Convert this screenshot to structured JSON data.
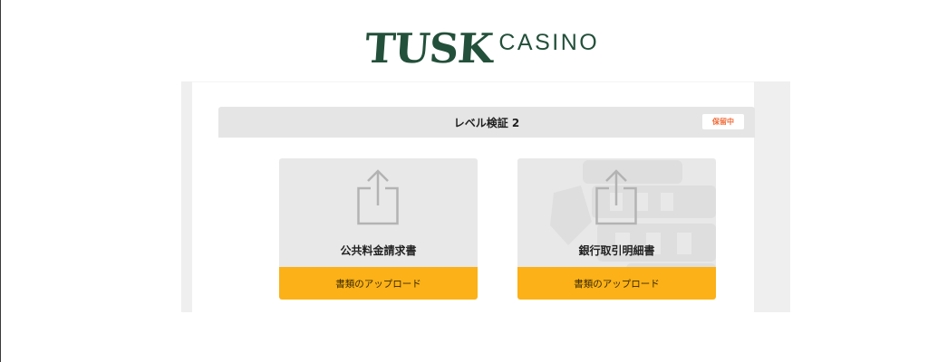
{
  "brand": {
    "name_primary": "TUSK",
    "name_secondary": "CASINO",
    "color": "#23503a"
  },
  "verification": {
    "title": "レベル検証 2",
    "status": "保留中",
    "status_color": "#f06a36"
  },
  "documents": [
    {
      "title": "公共料金請求書",
      "button_label": "書類のアップロード",
      "icon": "upload-icon"
    },
    {
      "title": "銀行取引明細書",
      "button_label": "書類のアップロード",
      "icon": "upload-icon"
    }
  ],
  "colors": {
    "accent": "#fbb117",
    "panel_bg": "#efefef",
    "card_bg": "#e8e8e8",
    "header_bg": "#e5e5e5"
  }
}
